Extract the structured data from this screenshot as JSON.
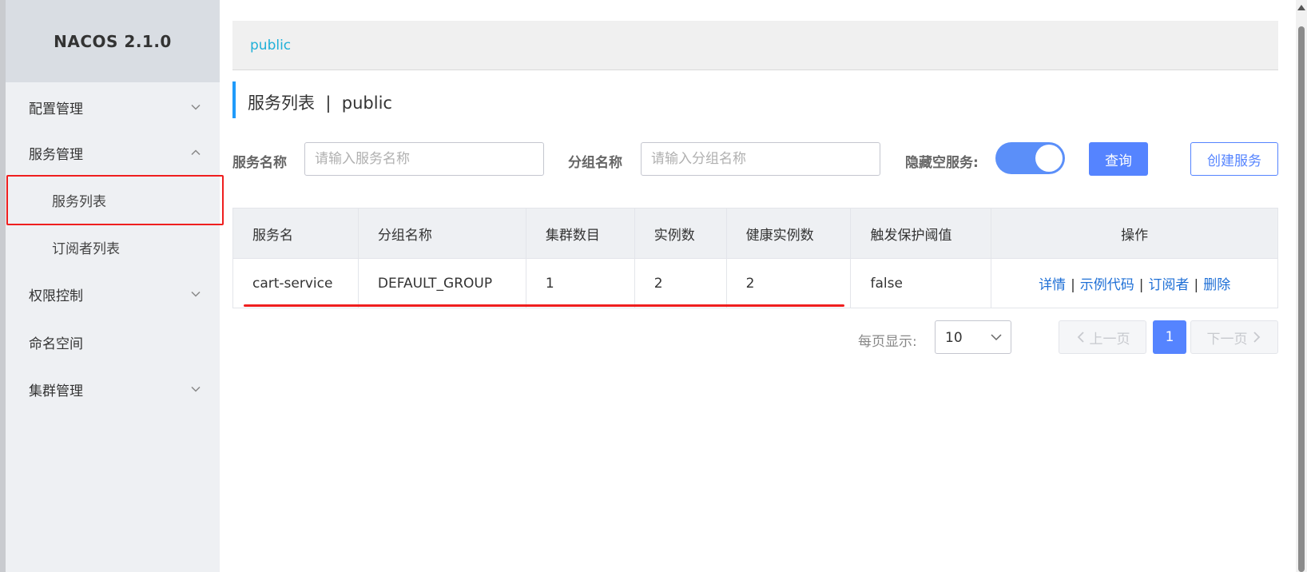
{
  "sidebar": {
    "brand": "NACOS 2.1.0",
    "items": [
      {
        "label": "配置管理"
      },
      {
        "label": "服务管理"
      },
      {
        "label": "服务列表"
      },
      {
        "label": "订阅者列表"
      },
      {
        "label": "权限控制"
      },
      {
        "label": "命名空间"
      },
      {
        "label": "集群管理"
      }
    ]
  },
  "namespace_bar": {
    "current": "public"
  },
  "page": {
    "title": "服务列表  |  public"
  },
  "filter": {
    "service_name_label": "服务名称",
    "service_name_placeholder": "请输入服务名称",
    "service_name_value": "",
    "group_name_label": "分组名称",
    "group_name_placeholder": "请输入分组名称",
    "group_name_value": "",
    "hide_empty_label": "隐藏空服务:",
    "hide_empty_on": true,
    "query_button": "查询",
    "create_button": "创建服务"
  },
  "table": {
    "columns": [
      "服务名",
      "分组名称",
      "集群数目",
      "实例数",
      "健康实例数",
      "触发保护阈值",
      "操作"
    ],
    "rows": [
      {
        "service": "cart-service",
        "group": "DEFAULT_GROUP",
        "clusters": "1",
        "instances": "2",
        "healthy": "2",
        "threshold": "false",
        "ops": [
          "详情",
          "示例代码",
          "订阅者",
          "删除"
        ],
        "op_separator": "|"
      }
    ]
  },
  "pagination": {
    "per_page_label": "每页显示:",
    "per_page_value": "10",
    "prev_label": "上一页",
    "next_label": "下一页",
    "current_page": "1"
  },
  "colors": {
    "accent": "#5584ff",
    "namespace_link": "#1fb0d8",
    "annotation_red": "#ef1e1e",
    "sidebar_bg": "#eef0f3"
  }
}
